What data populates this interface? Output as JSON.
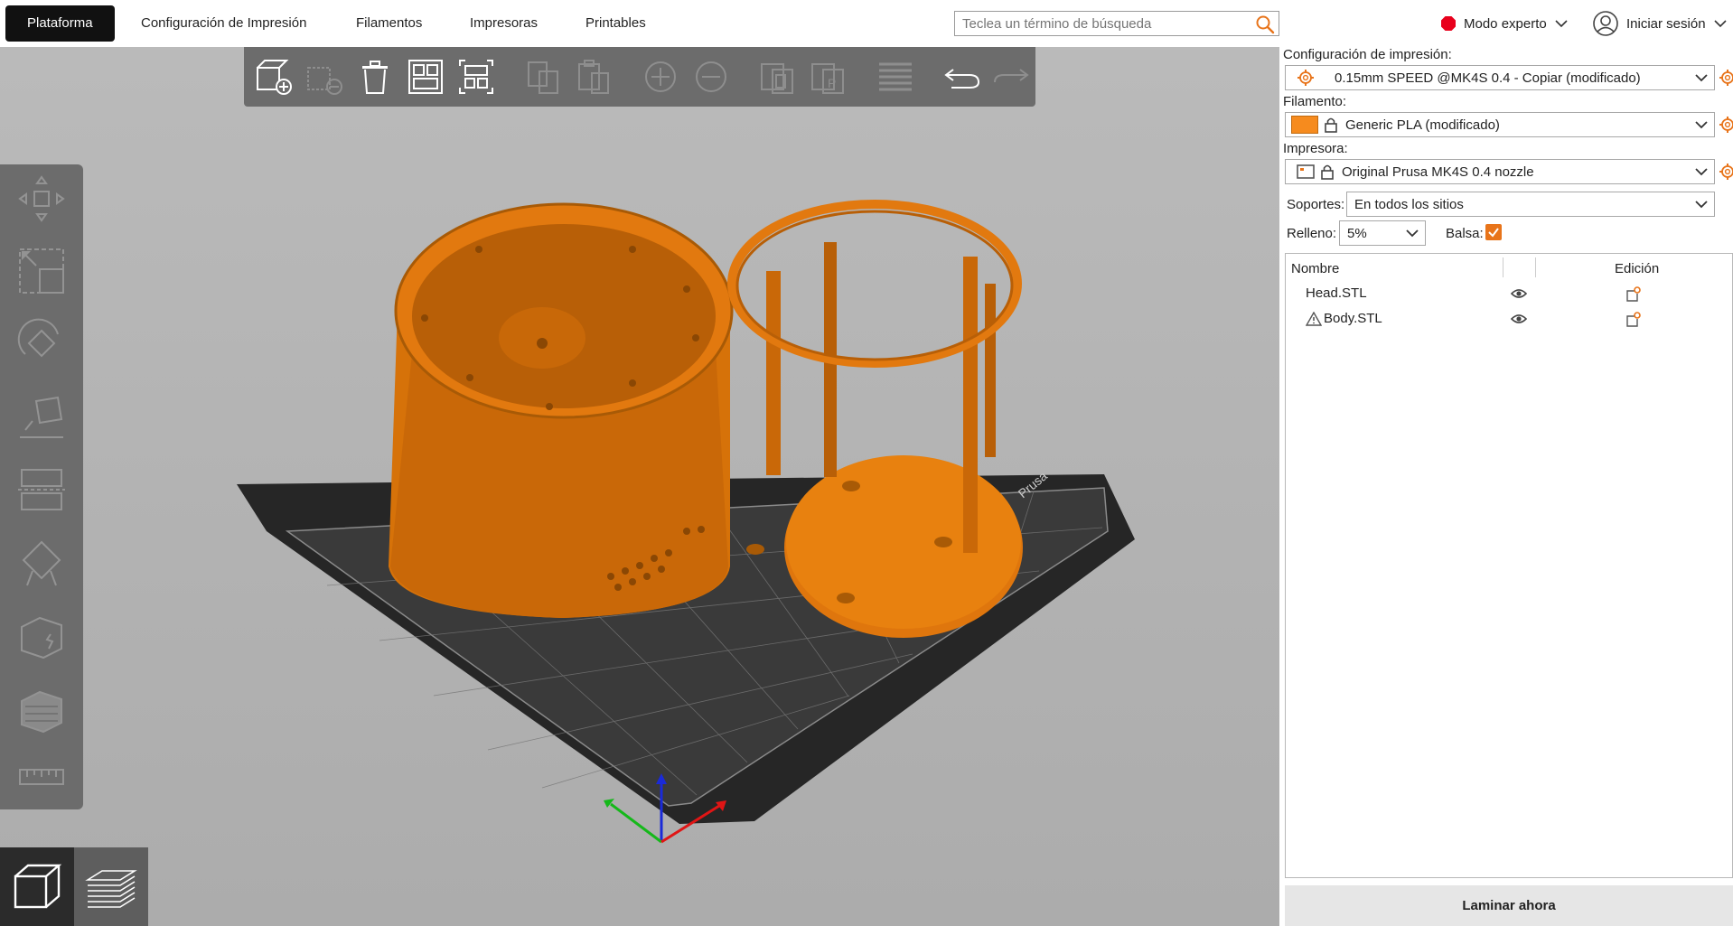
{
  "topbar": {
    "tabs": [
      {
        "label": "Plataforma",
        "active": true
      },
      {
        "label": "Configuración de Impresión",
        "active": false
      },
      {
        "label": "Filamentos",
        "active": false
      },
      {
        "label": "Impresoras",
        "active": false
      },
      {
        "label": "Printables",
        "active": false
      }
    ],
    "search": {
      "placeholder": "Teclea un término de búsqueda",
      "icon": "search-icon"
    },
    "mode": {
      "label": "Modo experto",
      "color": "#e8001c"
    },
    "login": {
      "label": "Iniciar sesión",
      "icon": "user-icon"
    }
  },
  "viewport": {
    "toolbar_icons": [
      "add-icon",
      "delete-icon",
      "delete-all-icon",
      "arrange-icon",
      "split-icon",
      "copy-icon",
      "paste-icon",
      "add-instance-icon",
      "remove-instance-icon",
      "split-objects-icon",
      "split-parts-icon",
      "layers-icon",
      "undo-icon",
      "redo-icon"
    ],
    "left_tools": [
      "move-icon",
      "scale-icon",
      "rotate-icon",
      "place-on-face-icon",
      "cut-icon",
      "support-paint-icon",
      "seam-paint-icon",
      "mmu-paint-icon",
      "measure-icon"
    ],
    "bed_label": "Prusa",
    "model_color": "#e2790f"
  },
  "panel": {
    "print_config": {
      "label": "Configuración de impresión:",
      "value": "0.15mm SPEED @MK4S 0.4 - Copiar (modificado)"
    },
    "filament": {
      "label": "Filamento:",
      "value": "Generic PLA (modificado)",
      "color": "#f68b1e"
    },
    "printer": {
      "label": "Impresora:",
      "value": "Original Prusa MK4S 0.4 nozzle"
    },
    "supports": {
      "label": "Soportes:",
      "value": "En todos los sitios"
    },
    "infill": {
      "label": "Relleno:",
      "value": "5%"
    },
    "raft": {
      "label": "Balsa:",
      "checked": true
    },
    "object_list": {
      "col_name": "Nombre",
      "col_edit": "Edición",
      "items": [
        {
          "name": "Head.STL",
          "warning": false
        },
        {
          "name": "Body.STL",
          "warning": true
        }
      ]
    },
    "slice_button": "Laminar ahora"
  }
}
